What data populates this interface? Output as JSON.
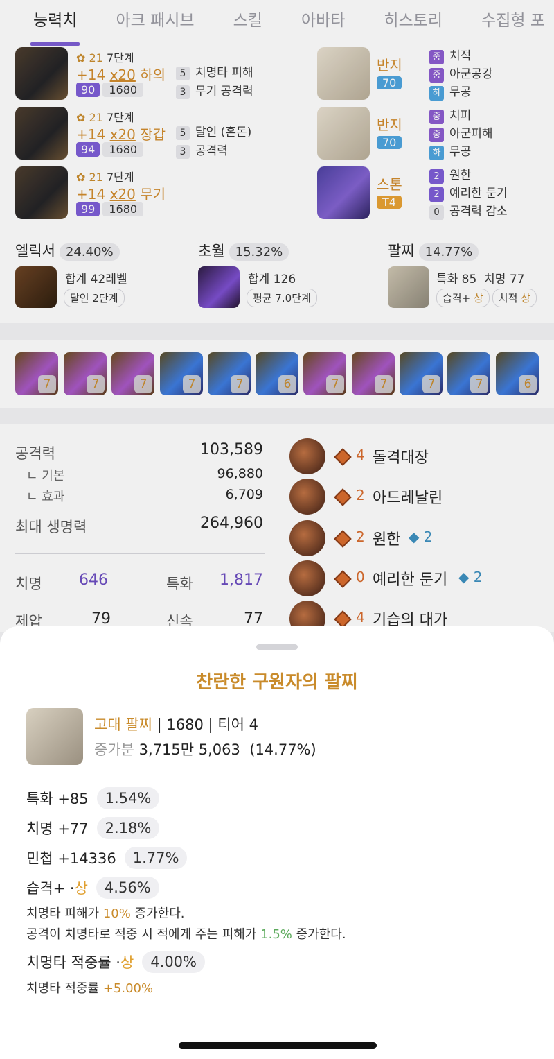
{
  "tabs": [
    "능력치",
    "아크 패시브",
    "스킬",
    "아바타",
    "히스토리",
    "수집형 포"
  ],
  "equipment": [
    {
      "level_icon": "21",
      "stage": "7단계",
      "upgrade": "+14",
      "advanced": "x20",
      "part": "하의",
      "item_level_a": "90",
      "item_level_b": "1680",
      "opt1_n": "5",
      "opt1": "치명타 피해",
      "opt2_n": "3",
      "opt2": "무기 공격력"
    },
    {
      "level_icon": "21",
      "stage": "7단계",
      "upgrade": "+14",
      "advanced": "x20",
      "part": "장갑",
      "item_level_a": "94",
      "item_level_b": "1680",
      "opt1_n": "5",
      "opt1": "달인 (혼돈)",
      "opt2_n": "3",
      "opt2": "공격력"
    },
    {
      "level_icon": "21",
      "stage": "7단계",
      "upgrade": "+14",
      "advanced": "x20",
      "part": "무기",
      "item_level_a": "99",
      "item_level_b": "1680"
    }
  ],
  "accessories": [
    {
      "name": "반지",
      "badge": "70",
      "opts": [
        {
          "grade": "중",
          "text": "치적"
        },
        {
          "grade": "중",
          "text": "아군공강"
        },
        {
          "grade": "하",
          "text": "무공"
        }
      ]
    },
    {
      "name": "반지",
      "badge": "70",
      "opts": [
        {
          "grade": "중",
          "text": "치피"
        },
        {
          "grade": "중",
          "text": "아군피해"
        },
        {
          "grade": "하",
          "text": "무공"
        }
      ]
    },
    {
      "name": "스톤",
      "badge": "T4",
      "opts": [
        {
          "grade": "2",
          "text": "원한"
        },
        {
          "grade": "2",
          "text": "예리한 둔기"
        },
        {
          "grade": "0",
          "text": "공격력 감소"
        }
      ]
    }
  ],
  "summary": {
    "elixir": {
      "title": "엘릭서",
      "pct": "24.40%",
      "line1": "합계 42레벨",
      "line2": "달인 2단계"
    },
    "transcend": {
      "title": "초월",
      "pct": "15.32%",
      "line1": "합계 126",
      "line2": "평균 7.0단계"
    },
    "bracelet": {
      "title": "팔찌",
      "pct": "14.77%",
      "line1a": "특화 85",
      "line1b": "치명 77",
      "pill1": "습격+",
      "pill1_grade": "상",
      "pill2": "치적",
      "pill2_grade": "상"
    }
  },
  "gems": [
    "7",
    "7",
    "7",
    "7",
    "7",
    "6",
    "7",
    "7",
    "7",
    "7",
    "6"
  ],
  "stats": {
    "attack_label": "공격력",
    "attack": "103,589",
    "base_label": "ㄴ 기본",
    "base": "96,880",
    "effect_label": "ㄴ 효과",
    "effect": "6,709",
    "hp_label": "최대 생명력",
    "hp": "264,960",
    "crit_label": "치명",
    "crit": "646",
    "spec_label": "특화",
    "spec": "1,817",
    "dom_label": "제압",
    "dom": "79",
    "swift_label": "신속",
    "swift": "77"
  },
  "engravings": [
    {
      "lv": "4",
      "name": "돌격대장",
      "stone": ""
    },
    {
      "lv": "2",
      "name": "아드레날린",
      "stone": ""
    },
    {
      "lv": "2",
      "name": "원한",
      "stone": "2"
    },
    {
      "lv": "0",
      "name": "예리한 둔기",
      "stone": "2"
    },
    {
      "lv": "4",
      "name": "기습의 대가",
      "stone": ""
    }
  ],
  "sheet": {
    "title": "찬란한 구원자의 팔찌",
    "grade": "고대 팔찌",
    "sep1": " | ",
    "item_level": "1680",
    "sep2": " | ",
    "tier": "티어 4",
    "increase_label": "증가분",
    "increase_value": "3,715만 5,063",
    "increase_pct": "(14.77%)",
    "lines": [
      {
        "label": "특화 +85",
        "pct": "1.54%"
      },
      {
        "label": "치명 +77",
        "pct": "2.18%"
      },
      {
        "label": "민첩 +14336",
        "pct": "1.77%"
      }
    ],
    "ambush": {
      "label": "습격+ · ",
      "grade": "상",
      "pct": "4.56%"
    },
    "ambush_desc1_pre": "치명타 피해가 ",
    "ambush_desc1_val": "10%",
    "ambush_desc1_post": " 증가한다.",
    "ambush_desc2_pre": "공격이 치명타로 적중 시 적에게 주는 피해가 ",
    "ambush_desc2_val": "1.5%",
    "ambush_desc2_post": " 증가한다.",
    "critrate": {
      "label": "치명타 적중률 · ",
      "grade": "상",
      "pct": "4.00%"
    },
    "critrate_desc_pre": "치명타 적중률 ",
    "critrate_desc_val": "+5.00%"
  }
}
